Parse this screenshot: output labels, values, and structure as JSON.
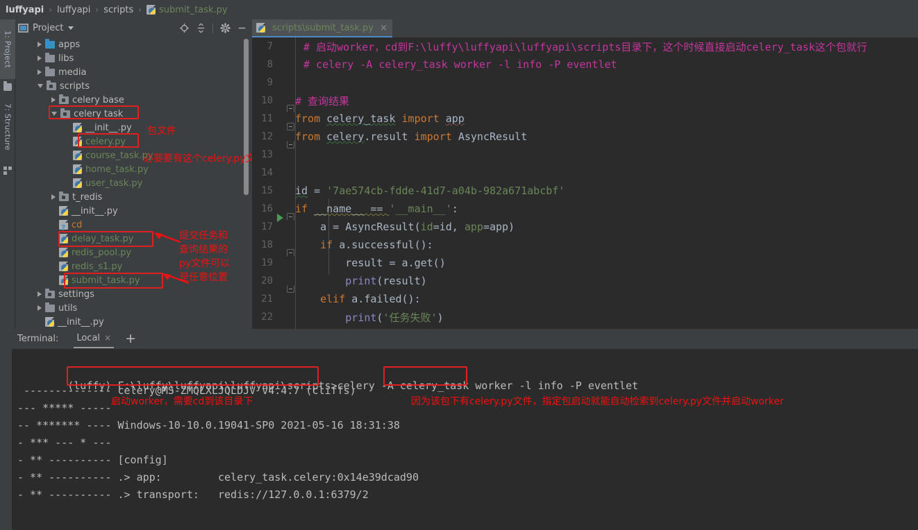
{
  "breadcrumb": {
    "items": [
      {
        "label": "luffyapi",
        "bold": true
      },
      {
        "label": "luffyapi",
        "bold": false
      },
      {
        "label": "scripts",
        "bold": false
      }
    ],
    "file": "submit_task.py",
    "separator": "›"
  },
  "toolstrip": {
    "project_label": "1: Project",
    "structure_label": "7: Structure"
  },
  "project_panel": {
    "title": "Project",
    "actions": [
      "locate-icon",
      "collapse-all-icon",
      "settings-icon",
      "hide-icon"
    ],
    "tree": [
      {
        "indent": 1,
        "arrow": "right",
        "icon": "folder-blue",
        "label": "apps",
        "color": "normal"
      },
      {
        "indent": 1,
        "arrow": "right",
        "icon": "folder",
        "label": "libs",
        "color": "normal"
      },
      {
        "indent": 1,
        "arrow": "right",
        "icon": "folder",
        "label": "media",
        "color": "normal"
      },
      {
        "indent": 1,
        "arrow": "down",
        "icon": "folder-mod",
        "label": "scripts",
        "color": "normal"
      },
      {
        "indent": 2,
        "arrow": "right",
        "icon": "folder-mod",
        "label": "celery base",
        "color": "normal"
      },
      {
        "indent": 2,
        "arrow": "down",
        "icon": "folder-mod",
        "label": "celery task",
        "color": "normal"
      },
      {
        "indent": 3,
        "arrow": "none",
        "icon": "python",
        "label": "__init__.py",
        "color": "normal"
      },
      {
        "indent": 3,
        "arrow": "none",
        "icon": "python",
        "label": "celery.py",
        "color": "green"
      },
      {
        "indent": 3,
        "arrow": "none",
        "icon": "python",
        "label": "course_task.py",
        "color": "green"
      },
      {
        "indent": 3,
        "arrow": "none",
        "icon": "python",
        "label": "home_task.py",
        "color": "green"
      },
      {
        "indent": 3,
        "arrow": "none",
        "icon": "python",
        "label": "user_task.py",
        "color": "green"
      },
      {
        "indent": 2,
        "arrow": "right",
        "icon": "folder-mod",
        "label": "t_redis",
        "color": "normal"
      },
      {
        "indent": 2,
        "arrow": "none",
        "icon": "python",
        "label": "__init__.py",
        "color": "normal"
      },
      {
        "indent": 2,
        "arrow": "none",
        "icon": "unknown",
        "label": "cd",
        "color": "orange"
      },
      {
        "indent": 2,
        "arrow": "none",
        "icon": "python",
        "label": "delay_task.py",
        "color": "green"
      },
      {
        "indent": 2,
        "arrow": "none",
        "icon": "python",
        "label": "redis_pool.py",
        "color": "green"
      },
      {
        "indent": 2,
        "arrow": "none",
        "icon": "python",
        "label": "redis_s1.py",
        "color": "green"
      },
      {
        "indent": 2,
        "arrow": "none",
        "icon": "python",
        "label": "submit_task.py",
        "color": "green"
      },
      {
        "indent": 1,
        "arrow": "right",
        "icon": "folder-mod",
        "label": "settings",
        "color": "normal"
      },
      {
        "indent": 1,
        "arrow": "right",
        "icon": "folder",
        "label": "utils",
        "color": "normal"
      },
      {
        "indent": 1,
        "arrow": "none",
        "icon": "python",
        "label": "__init__.py",
        "color": "normal"
      }
    ]
  },
  "annotations": {
    "color": "#ee1111",
    "tree": [
      {
        "text": "包文件"
      },
      {
        "text": "必要要有这个celery.py文件"
      },
      {
        "text": "提交任务和\n查询结果的\npy文件可以\n是任意位置"
      }
    ],
    "terminal": [
      {
        "text": "启动worker，需要cd到该目录下"
      },
      {
        "text": "因为该包下有celery.py文件，指定包启动就能自动检索到celery.py文件并启动worker"
      }
    ]
  },
  "editor": {
    "tab": {
      "label": "scripts\\submit_task.py",
      "close": "×",
      "icon": "python-file-icon"
    },
    "lines": [
      {
        "num": "7",
        "fold": "none",
        "run": false,
        "segments": [
          {
            "t": "# 启动worker，cd到F:\\luffy\\luffyapi\\luffyapi\\scripts目录下，这个时候直接启动celery_task这个包就行",
            "c": "com"
          }
        ],
        "indent": 1
      },
      {
        "num": "8",
        "fold": "none",
        "run": false,
        "segments": [
          {
            "t": "# celery -A celery_task worker -l info -P eventlet",
            "c": "com"
          }
        ],
        "indent": 1
      },
      {
        "num": "9",
        "fold": "none",
        "run": false,
        "segments": [],
        "indent": 0
      },
      {
        "num": "10",
        "fold": "top",
        "run": false,
        "segments": [
          {
            "t": "# 查询结果",
            "c": "com"
          }
        ],
        "indent": 0
      },
      {
        "num": "11",
        "fold": "mid",
        "run": false,
        "segments": [
          {
            "t": "from ",
            "c": "kw"
          },
          {
            "t": "celery_task",
            "c": "sq"
          },
          {
            "t": " import ",
            "c": "kw"
          },
          {
            "t": "app",
            "c": "sq-r"
          }
        ],
        "indent": 0
      },
      {
        "num": "12",
        "fold": "bot",
        "run": false,
        "segments": [
          {
            "t": "from ",
            "c": "kw"
          },
          {
            "t": "celery",
            "c": "sq"
          },
          {
            "t": ".result",
            "c": "plain"
          },
          {
            "t": " import ",
            "c": "kw"
          },
          {
            "t": "AsyncResult",
            "c": "plain"
          }
        ],
        "indent": 0
      },
      {
        "num": "13",
        "fold": "none",
        "run": false,
        "segments": [],
        "indent": 0
      },
      {
        "num": "14",
        "fold": "none",
        "run": false,
        "segments": [],
        "indent": 0
      },
      {
        "num": "15",
        "fold": "none",
        "run": false,
        "segments": [
          {
            "t": "id",
            "c": "sq"
          },
          {
            "t": " = ",
            "c": "plain"
          },
          {
            "t": "'7ae574cb-fdde-41d7-a04b-982a671abcbf'",
            "c": "str"
          }
        ],
        "indent": 0
      },
      {
        "num": "16",
        "fold": "top",
        "run": true,
        "segments": [
          {
            "t": "if ",
            "c": "kw"
          },
          {
            "t": "__name__ == ",
            "c": "sq-y"
          },
          {
            "t": "'__main__'",
            "c": "str"
          },
          {
            "t": ":",
            "c": "plain"
          }
        ],
        "indent": 0
      },
      {
        "num": "17",
        "fold": "none",
        "run": false,
        "segments": [
          {
            "t": "    a = AsyncResult(",
            "c": "plain"
          },
          {
            "t": "id",
            "c": "str"
          },
          {
            "t": "=id, ",
            "c": "plain"
          },
          {
            "t": "app",
            "c": "str"
          },
          {
            "t": "=app)",
            "c": "plain"
          }
        ],
        "indent": 0
      },
      {
        "num": "18",
        "fold": "top",
        "run": false,
        "segments": [
          {
            "t": "    ",
            "c": "plain"
          },
          {
            "t": "if ",
            "c": "kw"
          },
          {
            "t": "a.successful():",
            "c": "plain"
          }
        ],
        "indent": 0
      },
      {
        "num": "19",
        "fold": "none",
        "run": false,
        "segments": [
          {
            "t": "        result = a.get()",
            "c": "plain"
          }
        ],
        "indent": 0
      },
      {
        "num": "20",
        "fold": "bot",
        "run": false,
        "segments": [
          {
            "t": "        ",
            "c": "plain"
          },
          {
            "t": "print",
            "c": "fn"
          },
          {
            "t": "(result)",
            "c": "plain"
          }
        ],
        "indent": 0
      },
      {
        "num": "21",
        "fold": "none",
        "run": false,
        "segments": [
          {
            "t": "    ",
            "c": "plain"
          },
          {
            "t": "elif ",
            "c": "kw"
          },
          {
            "t": "a.failed():",
            "c": "plain"
          }
        ],
        "indent": 0
      },
      {
        "num": "22",
        "fold": "none",
        "run": false,
        "segments": [
          {
            "t": "        ",
            "c": "plain"
          },
          {
            "t": "print",
            "c": "fn"
          },
          {
            "t": "(",
            "c": "plain"
          },
          {
            "t": "'任务失败'",
            "c": "str"
          },
          {
            "t": ")",
            "c": "plain"
          }
        ],
        "indent": 0
      }
    ]
  },
  "terminal": {
    "label": "Terminal:",
    "tab": "Local",
    "tab_close": "×",
    "add_tab": "+",
    "prompt_env": "(luffy)",
    "prompt_path": "F:\\luffy\\luffyapi\\luffyapi\\scripts>",
    "command_pre": "celery -A ",
    "command_app": "celery_task",
    "command_post": " worker -l info -P eventlet",
    "output": [
      " -------------- celery@MS-ZMQLXLJQLDJV v4.4.7 (cliffs)",
      "--- ***** -----",
      "-- ******* ---- Windows-10-10.0.19041-SP0 2021-05-16 18:31:38",
      "- *** --- * ---",
      "- ** ---------- [config]",
      "- ** ---------- .> app:         celery_task.celery:0x14e39dcad90",
      "- ** ---------- .> transport:   redis://127.0.0.1:6379/2"
    ]
  }
}
